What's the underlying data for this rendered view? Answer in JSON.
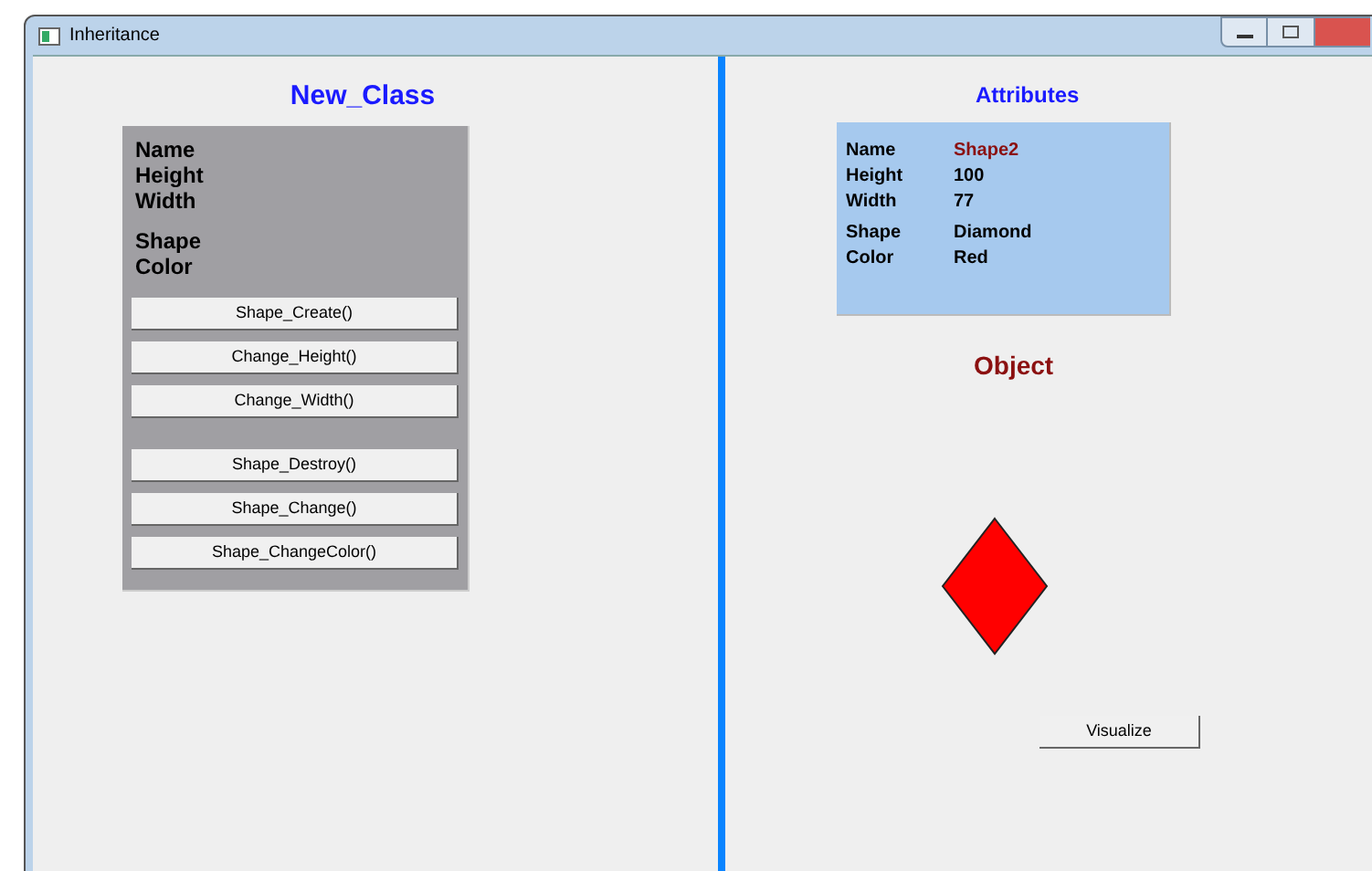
{
  "window": {
    "title": "Inheritance"
  },
  "class_panel": {
    "title": "New_Class",
    "field_groups": [
      [
        "Name",
        "Height",
        "Width"
      ],
      [
        "Shape",
        "Color"
      ]
    ],
    "button_groups": [
      [
        "Shape_Create()",
        "Change_Height()",
        "Change_Width()"
      ],
      [
        "Shape_Destroy()",
        "Shape_Change()",
        "Shape_ChangeColor()"
      ]
    ]
  },
  "attributes_panel": {
    "title": "Attributes",
    "groups": [
      [
        {
          "label": "Name",
          "value": "Shape2",
          "color": "#8b1010"
        },
        {
          "label": "Height",
          "value": "100",
          "color": "#000000"
        },
        {
          "label": "Width",
          "value": "77",
          "color": "#000000"
        }
      ],
      [
        {
          "label": "Shape",
          "value": "Diamond",
          "color": "#000000"
        },
        {
          "label": "Color",
          "value": "Red",
          "color": "#000000"
        }
      ]
    ]
  },
  "object_panel": {
    "title": "Object",
    "shape": {
      "kind": "diamond",
      "color": "#ff0000"
    },
    "button": "Visualize"
  }
}
